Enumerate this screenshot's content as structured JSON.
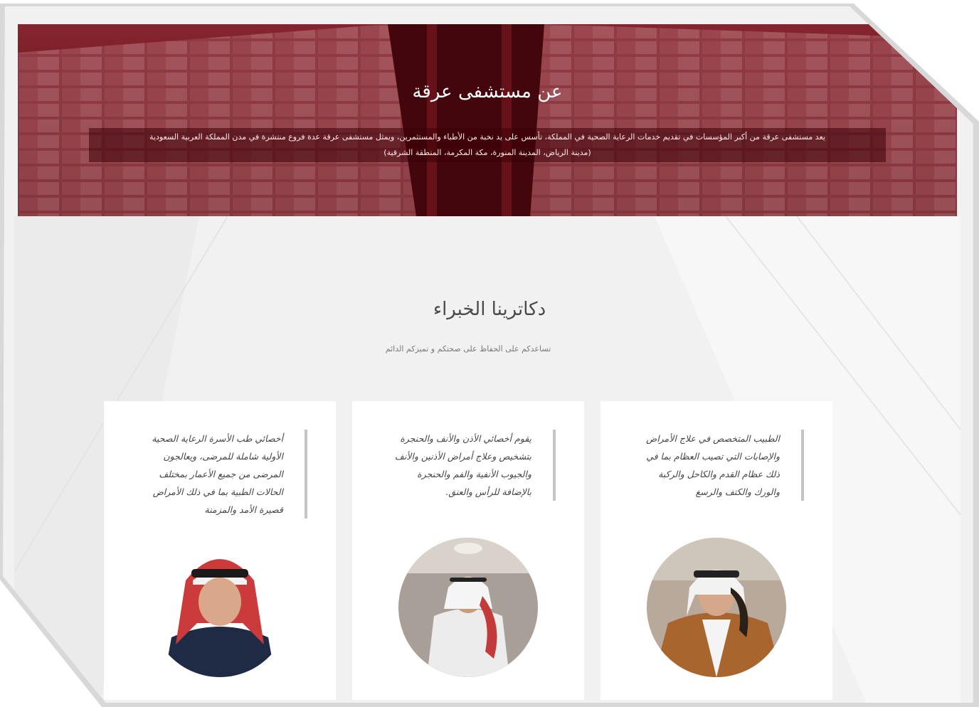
{
  "hero": {
    "title": "عن مستشفى عرقة",
    "text_line1": "يعد مستشفى عرقة من أكبر المؤسسات في تقديم خدمات الرعاية الصحية في المملكة، تأسس على يد نخبة من الأطباء والمستثمرين، ويمثل مستشفى عرقة عدة فروع منتشرة في مدن المملكة العربية السعودية",
    "text_line2": "(مدينة الرياض، المدينة المنورة، مكة المكرمة، المنطقة الشرقية)"
  },
  "doctors_section": {
    "title": "دكاترينا الخبراء",
    "subtitle": "تساعدكم على الحفاظ على صحتكم و تميزكم الدائم"
  },
  "cards": [
    {
      "description": "الطبيب المتخصص في علاج الأمراض والإصابات التي تصيب العظام بما في ذلك عظام القدم والكاحل والركبة والورك والكتف والرسغ",
      "avatar_icon": "doctor-photo-1"
    },
    {
      "description": "يقوم أخصائي الأذن والأنف والحنجرة بتشخيص وعلاج أمراض الأذنين والأنف والجيوب الأنفية والفم والحنجرة بالإضافة للرأس والعنق.",
      "avatar_icon": "doctor-photo-2"
    },
    {
      "description": "أخصائي طب الأسرة الرعاية الصحية الأولية شاملة للمرضى، ويعالجون المرضى من جميع الأعمار بمختلف الحالات الطبية بما في ذلك الأمراض قصيرة الأمد والمزمنة",
      "avatar_icon": "doctor-photo-3"
    }
  ],
  "colors": {
    "hero_red": "#8a1f2b",
    "background": "#f1f1f1",
    "quote_bar": "#c4c4c4"
  }
}
